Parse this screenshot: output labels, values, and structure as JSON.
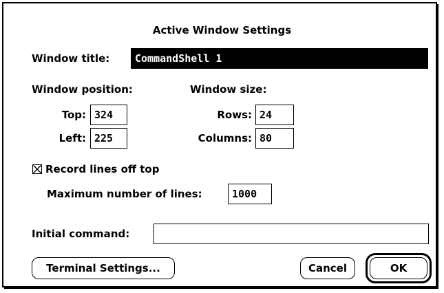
{
  "dialog": {
    "title": "Active Window Settings",
    "window_title_label": "Window title:",
    "window_title_value": "CommandShell 1",
    "position": {
      "heading": "Window position:",
      "top_label": "Top:",
      "top_value": "324",
      "left_label": "Left:",
      "left_value": "225"
    },
    "size": {
      "heading": "Window size:",
      "rows_label": "Rows:",
      "rows_value": "24",
      "columns_label": "Columns:",
      "columns_value": "80"
    },
    "record_lines": {
      "label": "Record lines off top",
      "checked": true,
      "max_label": "Maximum number of lines:",
      "max_value": "1000"
    },
    "initial_command": {
      "label": "Initial command:",
      "value": ""
    },
    "buttons": {
      "terminal_settings": "Terminal Settings...",
      "cancel": "Cancel",
      "ok": "OK"
    }
  }
}
